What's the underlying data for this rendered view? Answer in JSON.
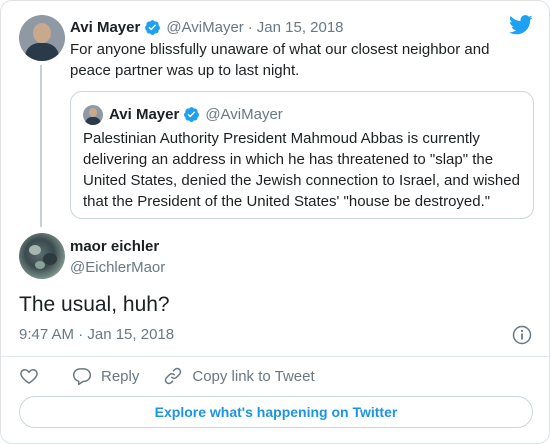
{
  "colors": {
    "text": "#1c2022",
    "muted": "#697882",
    "twitter_blue": "#1da1f2",
    "link_blue": "#1b95e0",
    "border": "#ccd6dd"
  },
  "parent_tweet": {
    "author_name": "Avi Mayer",
    "handle": "@AviMayer",
    "separator": "·",
    "date": "Jan 15, 2018",
    "text": "For anyone blissfully unaware of what our closest neighbor and peace partner was up to last night.",
    "verified_icon": "verified-badge-icon",
    "logo_icon": "twitter-bird-icon"
  },
  "quoted_tweet": {
    "author_name": "Avi Mayer",
    "handle": "@AviMayer",
    "text": "Palestinian Authority President Mahmoud Abbas is currently delivering an address in which he has threatened to \"slap\" the United States, denied the Jewish connection to Israel, and wished that the President of the United States' \"house be destroyed.\""
  },
  "reply_tweet": {
    "author_name": "maor eichler",
    "handle": "@EichlerMaor",
    "text": "The usual, huh?",
    "timestamp": "9:47 AM · Jan 15, 2018"
  },
  "actions": {
    "like_icon": "heart-icon",
    "reply_label": "Reply",
    "reply_icon": "reply-bubble-icon",
    "copy_link_label": "Copy link to Tweet",
    "copy_link_icon": "link-icon"
  },
  "footer": {
    "explore_label": "Explore what's happening on Twitter"
  }
}
